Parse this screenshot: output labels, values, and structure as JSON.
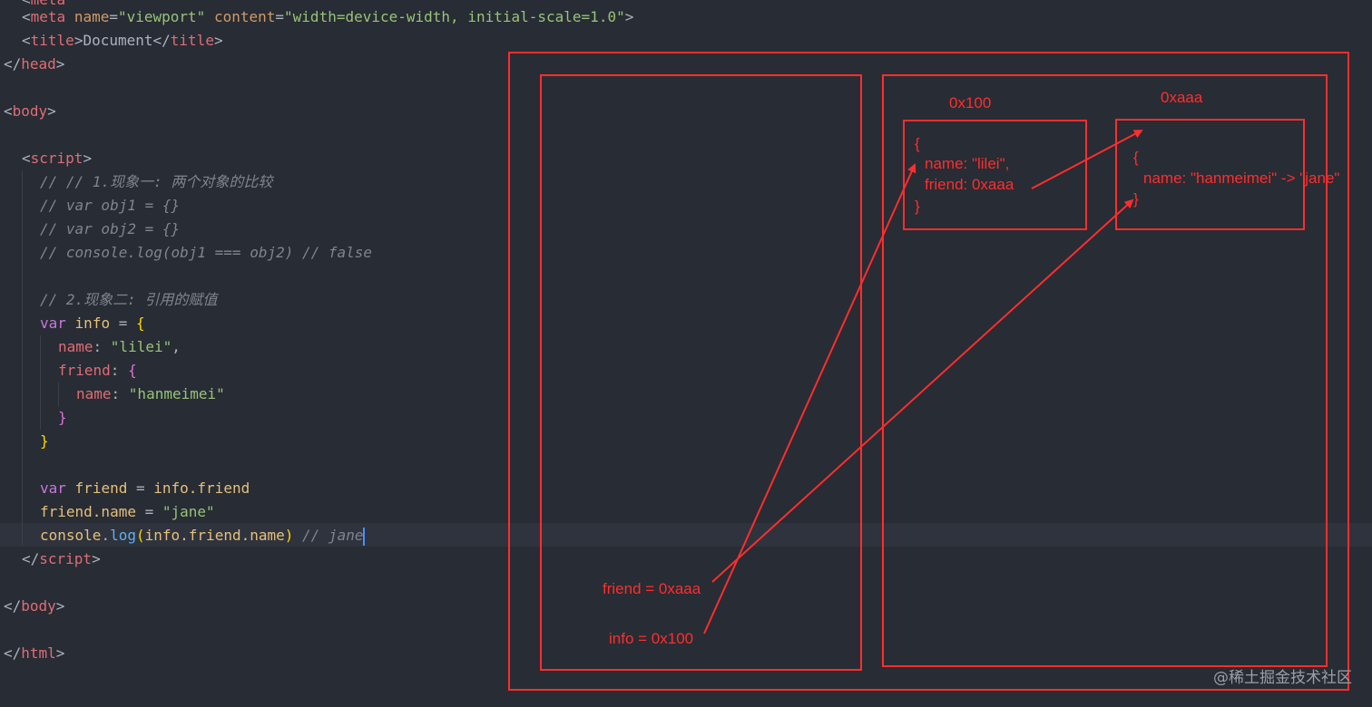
{
  "code": {
    "meta_tag": "meta",
    "meta_name_attr": "name",
    "meta_name_val": "\"viewport\"",
    "meta_content_attr": "content",
    "meta_content_val": "\"width=device-width, initial-scale=1.0\"",
    "title_tag": "title",
    "title_text": "Document",
    "head_tag": "head",
    "body_tag": "body",
    "script_tag": "script",
    "html_tag": "html",
    "comment_1": "// // 1.现象一: 两个对象的比较",
    "comment_2": "// var obj1 = {}",
    "comment_3": "// var obj2 = {}",
    "comment_4": "// console.log(obj1 === obj2) // false",
    "comment_5": "// 2.现象二: 引用的赋值",
    "kw_var": "var",
    "var_info": "info",
    "eq": " = ",
    "prop_name": "name",
    "val_lilei": "\"lilei\"",
    "prop_friend": "friend",
    "val_hanmeimei": "\"hanmeimei\"",
    "var_friend": "friend",
    "info_friend_expr": "info.friend",
    "friend_name_expr": "friend.name",
    "val_jane": "\"jane\"",
    "console": "console",
    "log": "log",
    "log_arg": "info.friend.name",
    "comment_jane": "// jane"
  },
  "annotation": {
    "color": "#ff2d2d",
    "addr_info_obj": "0x100",
    "addr_friend_obj": "0xaaa",
    "obj1_open": "{",
    "obj1_line1": "name: \"lilei\",",
    "obj1_line2": "friend: 0xaaa",
    "obj1_close": "}",
    "obj2_open": "{",
    "obj2_line1": "name: \"hanmeimei\" -> \"jane\"",
    "obj2_close": "}",
    "stack_friend": "friend = 0xaaa",
    "stack_info": "info = 0x100"
  },
  "watermark": "@稀土掘金技术社区"
}
